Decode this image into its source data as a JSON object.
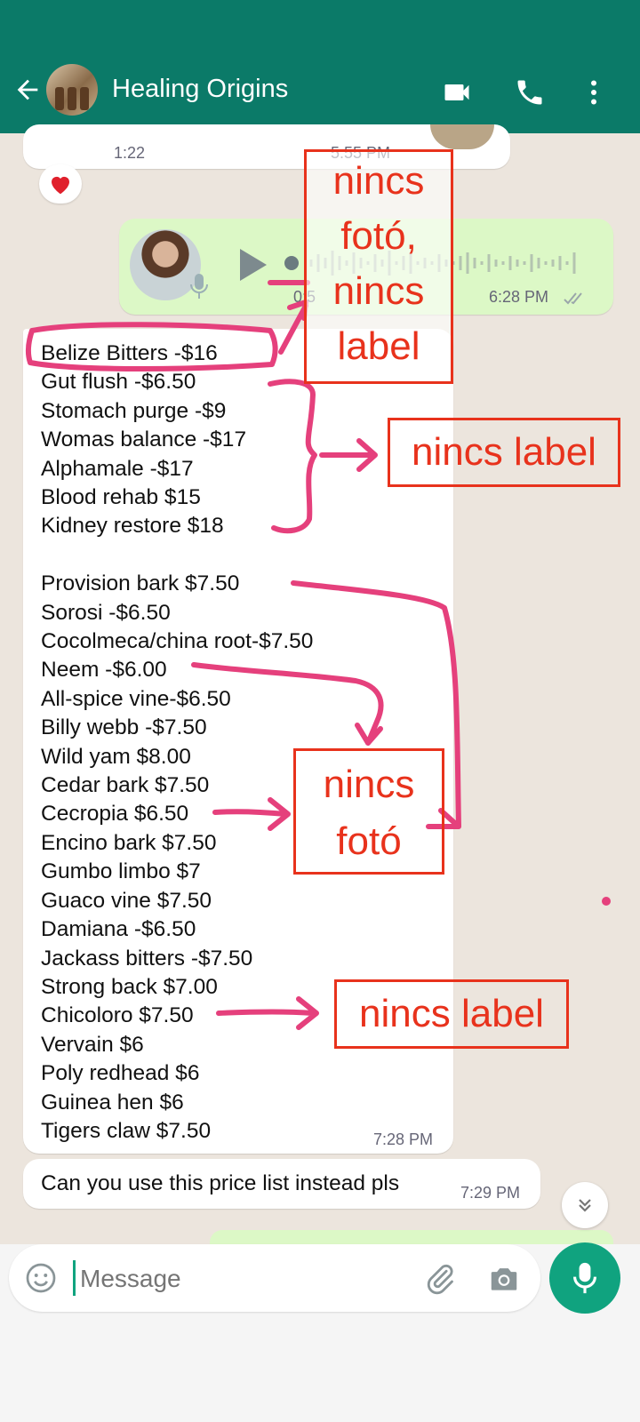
{
  "header": {
    "title": "Healing Origins",
    "icons": [
      "back-arrow-icon",
      "group-avatar",
      "video-call-icon",
      "phone-call-icon",
      "more-vert-icon"
    ]
  },
  "messages": {
    "top_partial": {
      "duration": "1:22",
      "time": "5:55 PM"
    },
    "voice_note": {
      "duration": "0:5",
      "time": "6:28 PM"
    },
    "price_list": {
      "items_group1": [
        "Belize Bitters -$16",
        "Gut flush -$6.50",
        "Stomach purge -$9",
        "Womas balance -$17",
        "Alphamale -$17",
        "Blood rehab $15",
        "Kidney restore $18"
      ],
      "items_group2": [
        "Provision bark $7.50",
        "Sorosi -$6.50",
        "Cocolmeca/china root-$7.50",
        "Neem -$6.00",
        "All-spice vine-$6.50",
        "Billy webb -$7.50",
        "Wild yam $8.00",
        "Cedar bark $7.50",
        "Cecropia $6.50",
        "Encino bark $7.50",
        "Gumbo limbo $7",
        "Guaco vine $7.50",
        "Damiana -$6.50",
        "Jackass bitters -$7.50",
        "Strong back $7.00",
        "Chicoloro $7.50",
        "Vervain $6",
        "Poly redhead $6",
        "Guinea hen $6",
        "Tigers claw $7.50"
      ],
      "time": "7:28 PM"
    },
    "followup": {
      "text": "Can you use this price list instead pls",
      "time": "7:29 PM"
    }
  },
  "annotations": {
    "box1_lines": [
      "nincs",
      "fotó,",
      "nincs",
      "label"
    ],
    "box2": "nincs label",
    "box3_lines": [
      "nincs",
      "fotó"
    ],
    "box4": "nincs label"
  },
  "composer": {
    "placeholder": "Message"
  },
  "colors": {
    "header": "#0b7a68",
    "annotation_red": "#e8321c",
    "annotation_pink": "#e5407c",
    "outgoing_bubble": "#dcf8c6",
    "mic_button": "#10a37f"
  }
}
